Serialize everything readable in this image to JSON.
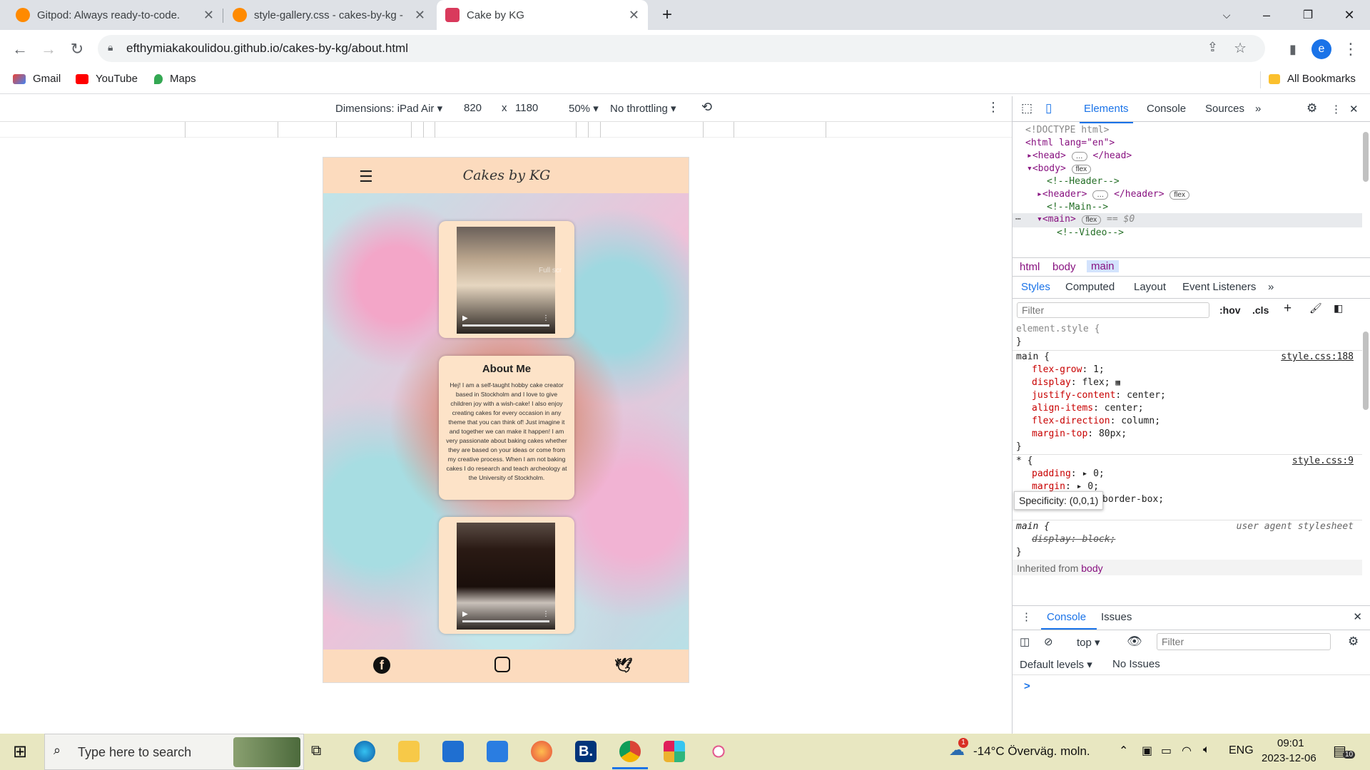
{
  "browser": {
    "tabs": [
      {
        "title": "Gitpod: Always ready-to-code.",
        "icon": "gitpod-icon"
      },
      {
        "title": "style-gallery.css - cakes-by-kg -",
        "icon": "gitpod-icon"
      },
      {
        "title": "Cake by KG",
        "icon": "cake-icon"
      }
    ],
    "url": "efthymiakakoulidou.github.io/cakes-by-kg/about.html",
    "profile_letter": "e",
    "bookmarks": [
      "Gmail",
      "YouTube",
      "Maps"
    ],
    "all_bookmarks": "All Bookmarks"
  },
  "device_toolbar": {
    "dimensions": "Dimensions: iPad Air",
    "width": "820",
    "times": "x",
    "height": "1180",
    "zoom": "50%",
    "throttling": "No throttling"
  },
  "site": {
    "brand": "Cakes by KG",
    "about_title": "About Me",
    "about_text": "Hej! I am a self-taught hobby cake creator based in Stockholm and I love to give children joy with a wish-cake! I also enjoy creating cakes for every occasion in any theme that you can think of! Just imagine it and together we can make it happen! I am very passionate about baking cakes whether they are based on your ideas or come from my creative process. When I am not baking cakes I do research and teach archeology at the University of Stockholm.",
    "video_tooltip": "Full scr"
  },
  "devtools": {
    "tabs": [
      "Elements",
      "Console",
      "Sources"
    ],
    "dom": {
      "doctype": "<!DOCTYPE html>",
      "html": "<html lang=\"en\">",
      "head": "<head>",
      "head_end": "</head>",
      "body": "<body>",
      "header_comment": "<!--Header-->",
      "header": "<header>",
      "header_end": "</header>",
      "main_comment": "<!--Main-->",
      "main": "<main>",
      "main_eq": "== $0",
      "video_comment": "<!--Video-->",
      "badge": "flex"
    },
    "breadcrumbs": [
      "html",
      "body",
      "main"
    ],
    "style_tabs": [
      "Styles",
      "Computed",
      "Layout",
      "Event Listeners"
    ],
    "filter_placeholder": "Filter",
    "hov": ":hov",
    "cls": ".cls",
    "rules": {
      "element_style": "element.style {",
      "close": "}",
      "main_selector": "main {",
      "main_source": "style.css:188",
      "main_props": [
        {
          "p": "flex-grow",
          "v": "1;"
        },
        {
          "p": "display",
          "v": "flex;"
        },
        {
          "p": "justify-content",
          "v": "center;"
        },
        {
          "p": "align-items",
          "v": "center;"
        },
        {
          "p": "flex-direction",
          "v": "column;"
        },
        {
          "p": "margin-top",
          "v": "80px;"
        }
      ],
      "star_selector": "* {",
      "star_source": "style.css:9",
      "star_props": [
        {
          "p": "padding",
          "v": "0;"
        },
        {
          "p": "margin",
          "v": "0;"
        }
      ],
      "star_partial": "border-box;",
      "specificity": "Specificity: (0,0,1)",
      "ua_selector": "main {",
      "ua_source": "user agent stylesheet",
      "ua_prop": "display: block;",
      "inherited": "Inherited from",
      "inherited_el": "body"
    },
    "drawer": {
      "tabs": [
        "Console",
        "Issues"
      ],
      "context": "top",
      "filter_placeholder": "Filter",
      "levels": "Default levels",
      "issues": "No Issues",
      "prompt": ">"
    }
  },
  "taskbar": {
    "search_placeholder": "Type here to search",
    "weather": "-14°C  Överväg. moln.",
    "weather_badge": "1",
    "lang": "ENG",
    "time": "09:01",
    "date": "2023-12-06",
    "notif_count": "10"
  },
  "colors": {
    "accent": "#1a73e8",
    "site_header": "#fcdbbe",
    "taskbar": "#e8e7c1"
  }
}
